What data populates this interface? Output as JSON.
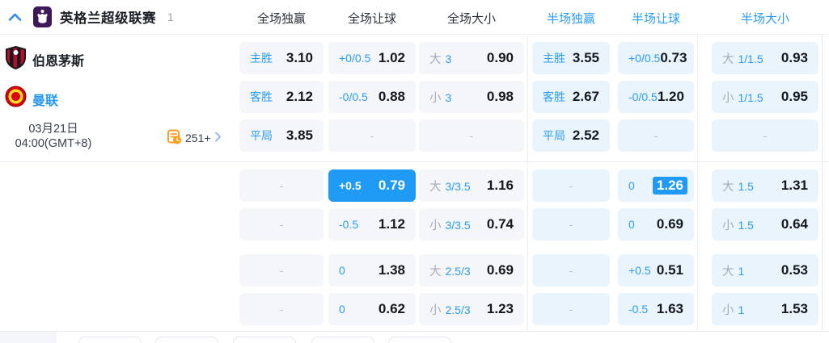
{
  "colors": {
    "accent_blue": "#1f9bf5",
    "label_blue": "#2b9cf4",
    "label_gray": "#a2abb8",
    "cell_gray_bg": "#f4f6f9",
    "cell_blue_bg": "#e9f4fd",
    "league_purple": "#3d195b",
    "orange": "#ff9d1f"
  },
  "league_header": {
    "league_name": "英格兰超级联赛",
    "match_count": "1",
    "columns": [
      {
        "label": "全场独赢",
        "tone": "dark"
      },
      {
        "label": "全场让球",
        "tone": "dark"
      },
      {
        "label": "全场大小",
        "tone": "dark"
      },
      {
        "label": "半场独赢",
        "tone": "blue"
      },
      {
        "label": "半场让球",
        "tone": "blue"
      },
      {
        "label": "半场大小",
        "tone": "blue"
      }
    ]
  },
  "match": {
    "home_team": "伯恩茅斯",
    "away_team": "曼联",
    "date": "03月21日",
    "time": "04:00(GMT+8)",
    "more_markets": "251+"
  },
  "odds_rows": [
    {
      "cells": [
        {
          "type": "pick",
          "label": "主胜",
          "value": "3.10"
        },
        {
          "type": "hcp",
          "label": "+0/0.5",
          "value": "1.02"
        },
        {
          "type": "ou",
          "side": "大",
          "line": "3",
          "value": "0.90"
        },
        {
          "type": "pick",
          "label": "主胜",
          "value": "3.55"
        },
        {
          "type": "hcp",
          "label": "+0/0.5",
          "value": "0.73"
        },
        {
          "type": "ou",
          "side": "大",
          "line": "1/1.5",
          "value": "0.93"
        }
      ]
    },
    {
      "cells": [
        {
          "type": "pick",
          "label": "客胜",
          "value": "2.12"
        },
        {
          "type": "hcp",
          "label": "-0/0.5",
          "value": "0.88"
        },
        {
          "type": "ou",
          "side": "小",
          "line": "3",
          "value": "0.98"
        },
        {
          "type": "pick",
          "label": "客胜",
          "value": "2.67"
        },
        {
          "type": "hcp",
          "label": "-0/0.5",
          "value": "1.20"
        },
        {
          "type": "ou",
          "side": "小",
          "line": "1/1.5",
          "value": "0.95"
        }
      ]
    },
    {
      "cells": [
        {
          "type": "pick",
          "label": "平局",
          "value": "3.85"
        },
        {
          "type": "dash",
          "value": "-"
        },
        {
          "type": "dash",
          "value": "-"
        },
        {
          "type": "pick",
          "label": "平局",
          "value": "2.52"
        },
        {
          "type": "dash",
          "value": "-"
        },
        {
          "type": "dash",
          "value": "-"
        }
      ]
    },
    {
      "cells": [
        {
          "type": "dash",
          "value": "-"
        },
        {
          "type": "hcp",
          "label": "+0.5",
          "value": "0.79",
          "highlight": "cell"
        },
        {
          "type": "ou",
          "side": "大",
          "line": "3/3.5",
          "value": "1.16"
        },
        {
          "type": "dash",
          "value": "-"
        },
        {
          "type": "hcp",
          "label": "0",
          "value": "1.26",
          "highlight": "value"
        },
        {
          "type": "ou",
          "side": "大",
          "line": "1.5",
          "value": "1.31"
        }
      ]
    },
    {
      "cells": [
        {
          "type": "dash",
          "value": "-"
        },
        {
          "type": "hcp",
          "label": "-0.5",
          "value": "1.12"
        },
        {
          "type": "ou",
          "side": "小",
          "line": "3/3.5",
          "value": "0.74"
        },
        {
          "type": "dash",
          "value": "-"
        },
        {
          "type": "hcp",
          "label": "0",
          "value": "0.69"
        },
        {
          "type": "ou",
          "side": "小",
          "line": "1.5",
          "value": "0.64"
        }
      ]
    },
    {
      "cells": [
        {
          "type": "dash",
          "value": "-"
        },
        {
          "type": "hcp",
          "label": "0",
          "value": "1.38"
        },
        {
          "type": "ou",
          "side": "大",
          "line": "2.5/3",
          "value": "0.69"
        },
        {
          "type": "dash",
          "value": "-"
        },
        {
          "type": "hcp",
          "label": "+0.5",
          "value": "0.51"
        },
        {
          "type": "ou",
          "side": "大",
          "line": "1",
          "value": "0.53"
        }
      ]
    },
    {
      "cells": [
        {
          "type": "dash",
          "value": "-"
        },
        {
          "type": "hcp",
          "label": "0",
          "value": "0.62"
        },
        {
          "type": "ou",
          "side": "小",
          "line": "2.5/3",
          "value": "1.23"
        },
        {
          "type": "dash",
          "value": "-"
        },
        {
          "type": "hcp",
          "label": "-0.5",
          "value": "1.63"
        },
        {
          "type": "ou",
          "side": "小",
          "line": "1",
          "value": "1.53"
        }
      ]
    }
  ]
}
